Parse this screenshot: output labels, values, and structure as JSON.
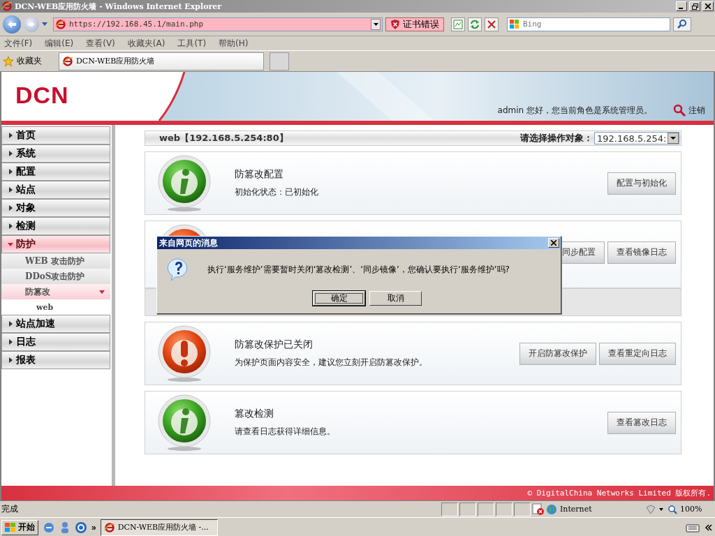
{
  "window": {
    "title": "DCN-WEB应用防火墙 - Windows Internet Explorer"
  },
  "address_bar": {
    "url": "https://192.168.45.1/main.php",
    "certificate": "证书错误"
  },
  "search": {
    "placeholder": "Bing"
  },
  "menu": [
    "文件(F)",
    "编辑(E)",
    "查看(V)",
    "收藏夹(A)",
    "工具(T)",
    "帮助(H)"
  ],
  "favorites": {
    "label": "收藏夹",
    "tab": "DCN-WEB应用防火墙"
  },
  "header": {
    "logo": "DCN",
    "greeting": "admin 您好，您当前角色是系统管理员。",
    "logout": "注销"
  },
  "sidebar": {
    "items": [
      {
        "label": "首页",
        "selected": false,
        "expanded": false
      },
      {
        "label": "系统",
        "selected": false,
        "expanded": false
      },
      {
        "label": "配置",
        "selected": false,
        "expanded": false
      },
      {
        "label": "站点",
        "selected": false,
        "expanded": false
      },
      {
        "label": "对象",
        "selected": false,
        "expanded": false
      },
      {
        "label": "检测",
        "selected": false,
        "expanded": false
      },
      {
        "label": "防护",
        "selected": true,
        "expanded": true,
        "children": [
          {
            "label": "WEB 攻击防护",
            "selected": false,
            "expanded": false
          },
          {
            "label": "DDoS攻击防护",
            "selected": false,
            "expanded": false
          },
          {
            "label": "防篡改",
            "selected": true,
            "expanded": true,
            "children": [
              {
                "label": "web",
                "selected": false
              }
            ]
          }
        ]
      },
      {
        "label": "站点加速",
        "selected": false,
        "expanded": false
      },
      {
        "label": "日志",
        "selected": false,
        "expanded": false
      },
      {
        "label": "报表",
        "selected": false,
        "expanded": false
      }
    ]
  },
  "target": {
    "title": "web【192.168.5.254:80】",
    "label": "请选择操作对象：",
    "value": "192.168.5.254:"
  },
  "cards": [
    {
      "kind": "info",
      "title": "防篡改配置",
      "description": "初始化状态：已初始化",
      "buttons": [
        "配置与初始化"
      ],
      "strip": false
    },
    {
      "kind": "alert",
      "buttons": [
        "同步配置",
        "查看镜像日志"
      ],
      "strip": true
    },
    {
      "kind": "alert",
      "title": "防篡改保护已关闭",
      "description": "为保护页面内容安全，建议您立刻开启防篡改保护。",
      "buttons": [
        "开启防篡改保护",
        "查看重定向日志"
      ],
      "strip": false
    },
    {
      "kind": "info",
      "title": "篡改检测",
      "description": "请查看日志获得详细信息。",
      "buttons": [
        "查看篡改日志"
      ],
      "strip": false
    }
  ],
  "dialog": {
    "title": "来自网页的消息",
    "message": "执行‘服务维护’需要暂时关闭‘篡改检测’、‘同步镜像’，您确认要执行‘服务维护’吗?",
    "buttons": [
      {
        "label": "确定",
        "default": true
      },
      {
        "label": "取消",
        "default": false
      }
    ]
  },
  "footer": "© DigitalChina Networks Limited 版权所有.",
  "status_bar": {
    "status": "完成",
    "zone": "Internet",
    "zoom": "100%"
  },
  "taskbar": {
    "start": "开始",
    "more": "»",
    "task": "DCN-WEB应用防火墙 -..."
  }
}
